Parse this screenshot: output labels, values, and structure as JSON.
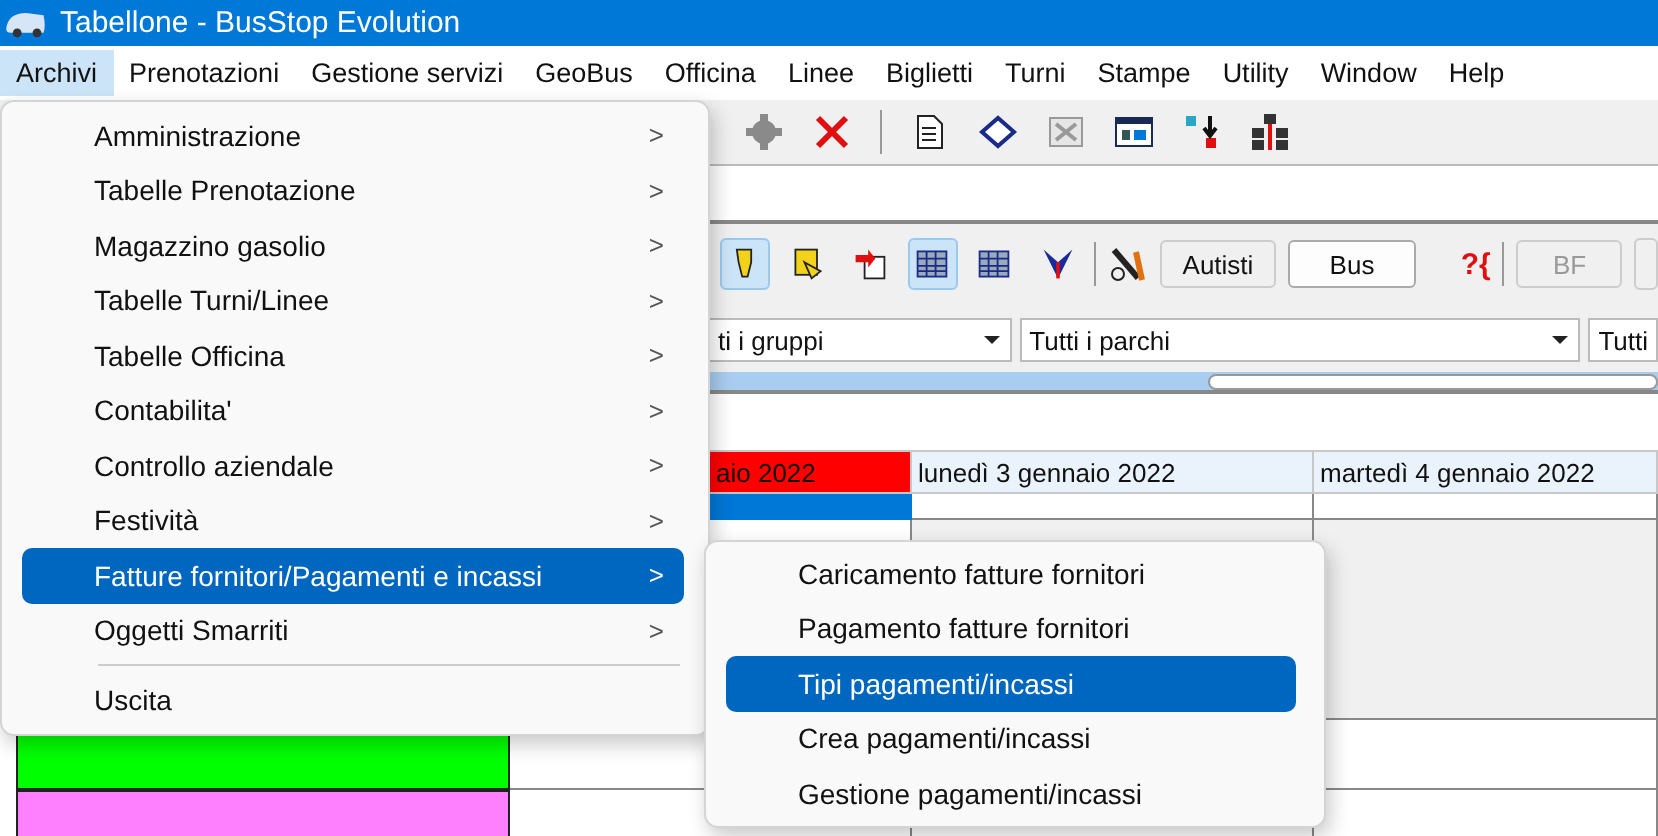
{
  "window": {
    "title": "Tabellone - BusStop Evolution"
  },
  "menubar": [
    {
      "label": "Archivi",
      "selected": true
    },
    {
      "label": "Prenotazioni",
      "selected": false
    },
    {
      "label": "Gestione servizi",
      "selected": false
    },
    {
      "label": "GeoBus",
      "selected": false
    },
    {
      "label": "Officina",
      "selected": false
    },
    {
      "label": "Linee",
      "selected": false
    },
    {
      "label": "Biglietti",
      "selected": false
    },
    {
      "label": "Turni",
      "selected": false
    },
    {
      "label": "Stampe",
      "selected": false
    },
    {
      "label": "Utility",
      "selected": false
    },
    {
      "label": "Window",
      "selected": false
    },
    {
      "label": "Help",
      "selected": false
    }
  ],
  "toolbar2": {
    "icons": [
      {
        "pressed": true
      },
      {
        "pressed": false
      },
      {
        "pressed": false
      },
      {
        "pressed": true
      },
      {
        "pressed": false
      },
      {
        "pressed": false
      }
    ],
    "buttons": [
      {
        "label": "Autisti",
        "disabled": false
      },
      {
        "label": "Bus",
        "disabled": false
      }
    ],
    "help_glyph": "?{",
    "disabled_buttons": [
      {
        "label": "BF",
        "disabled": true
      }
    ]
  },
  "filters": [
    "ti i gruppi",
    "Tutti i parchi",
    "Tutti"
  ],
  "grid": {
    "columns": [
      {
        "label": "aio 2022",
        "color": "#ff0000"
      },
      {
        "label": "lunedì 3 gennaio 2022",
        "color": "#eaf3fc"
      },
      {
        "label": "martedì 4 gennaio 2022",
        "color": "#eaf3fc"
      }
    ],
    "vehicle_rows": [
      {
        "color": "#00ff00"
      },
      {
        "color": "#ff80ff"
      }
    ]
  },
  "menu": {
    "items": [
      {
        "kind": "submenu",
        "label": "Amministrazione",
        "selected": false
      },
      {
        "kind": "submenu",
        "label": "Tabelle Prenotazione",
        "selected": false
      },
      {
        "kind": "submenu",
        "label": "Magazzino gasolio",
        "selected": false
      },
      {
        "kind": "submenu",
        "label": "Tabelle Turni/Linee",
        "selected": false
      },
      {
        "kind": "submenu",
        "label": "Tabelle Officina",
        "selected": false
      },
      {
        "kind": "submenu",
        "label": "Contabilita'",
        "selected": false
      },
      {
        "kind": "submenu",
        "label": "Controllo aziendale",
        "selected": false
      },
      {
        "kind": "submenu",
        "label": "Festività",
        "selected": false
      },
      {
        "kind": "submenu",
        "label": "Fatture fornitori/Pagamenti e incassi",
        "selected": true
      },
      {
        "kind": "submenu",
        "label": "Oggetti Smarriti",
        "selected": false
      },
      {
        "kind": "separator"
      },
      {
        "kind": "action",
        "label": "Uscita",
        "selected": false
      }
    ],
    "arrow_glyph": ">"
  },
  "submenu": {
    "items": [
      {
        "label": "Caricamento fatture fornitori",
        "selected": false
      },
      {
        "label": "Pagamento fatture fornitori",
        "selected": false
      },
      {
        "label": "Tipi pagamenti/incassi",
        "selected": true
      },
      {
        "label": "Crea pagamenti/incassi",
        "selected": false
      },
      {
        "label": "Gestione pagamenti/incassi",
        "selected": false
      }
    ]
  }
}
